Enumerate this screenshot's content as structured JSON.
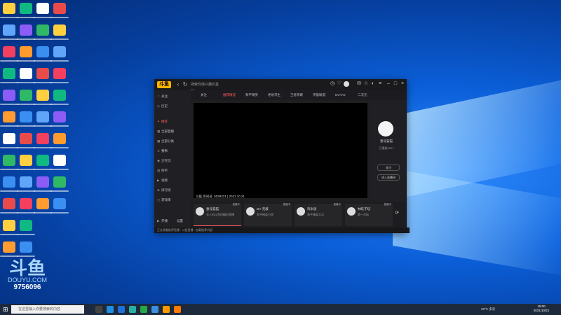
{
  "desktop": {
    "overlay_logo": "斗鱼",
    "overlay_brand": "DOUYU.COM",
    "overlay_room_id": "9756096"
  },
  "app": {
    "title_logo": "斗鱼",
    "search_placeholder": "搜索你感兴趣的直播",
    "sidebar": [
      {
        "label": "关注",
        "icon": "heart-icon"
      },
      {
        "label": "历史",
        "icon": "clock-icon"
      },
      {
        "label": "推荐",
        "icon": "flame-icon",
        "active": true
      },
      {
        "label": "全部直播",
        "icon": "grid-icon"
      },
      {
        "label": "全部分类",
        "icon": "grid-icon"
      },
      {
        "label": "赛事",
        "icon": "trophy-icon"
      },
      {
        "label": "正在玩",
        "icon": "gamepad-icon"
      },
      {
        "label": "榜单",
        "icon": "chart-icon"
      },
      {
        "label": "视频",
        "icon": "video-icon"
      },
      {
        "label": "排行榜",
        "icon": "list-icon"
      },
      {
        "label": "游戏库",
        "icon": "box-icon"
      }
    ],
    "sidebar_bottom": {
      "label_left": "开播",
      "label_right": "设置"
    },
    "tabs": [
      {
        "label": "关注"
      },
      {
        "label": "推荐精选",
        "active": true
      },
      {
        "label": "和平精英"
      },
      {
        "label": "绝地求生"
      },
      {
        "label": "王者荣耀"
      },
      {
        "label": "英雄联盟"
      },
      {
        "label": "DOTA2"
      },
      {
        "label": "二次元"
      }
    ],
    "video_caption": "斗鱼 房间号: 5039221 | 2021.10.21",
    "anchor": {
      "name": "壹号猫猫",
      "sub": "已播放2021",
      "follow": "关注",
      "enter": "进入直播间"
    },
    "recommendations": [
      {
        "name": "壹号猫猫",
        "title": "无人机斗鱼的精彩直播",
        "badge": "直播中"
      },
      {
        "name": "DA-无敌",
        "title": "和平精英万圣",
        "badge": "直播中"
      },
      {
        "name": "鸡米饭",
        "title": "和平精英大吉",
        "badge": "直播中"
      },
      {
        "name": "林吱子吱",
        "title": "第一次玩",
        "badge": "直播中"
      }
    ],
    "status_text": "正在观看推荐直播 · 斗鱼直播 · 加载推荐内容"
  },
  "taskbar": {
    "search_placeholder": "在这里输入你要搜索的内容",
    "tray_weather": "28°C 多云",
    "time": "15:00",
    "date": "2021/10/21"
  }
}
